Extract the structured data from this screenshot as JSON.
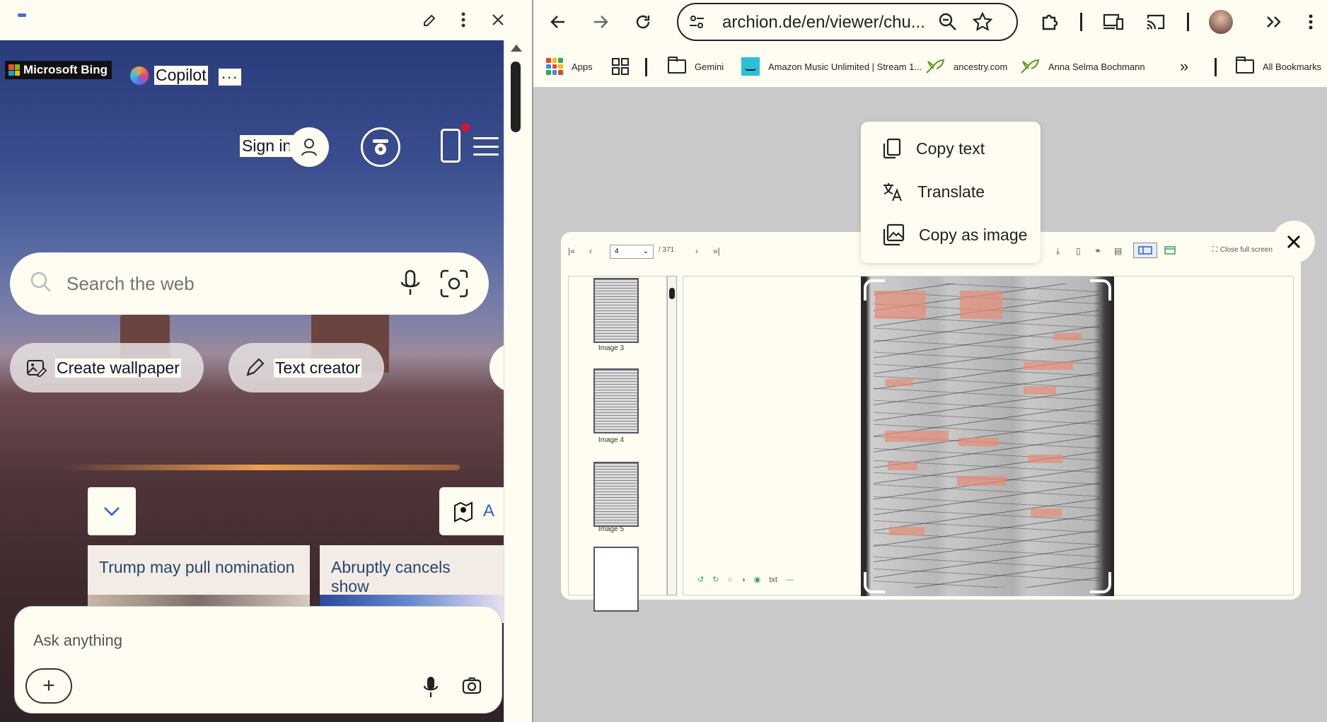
{
  "left_panel": {
    "bing_logo": "Microsoft Bing",
    "copilot_label": "Copilot",
    "more_label": "...",
    "sign_in": "Sign in",
    "search_placeholder": "Search the web",
    "pills": [
      "Create wallpaper",
      "Text creator"
    ],
    "location_partial": "A",
    "news": [
      "Trump may pull nomination",
      "Abruptly cancels show"
    ],
    "ask_placeholder": "Ask anything",
    "plus": "+"
  },
  "browser": {
    "url": "archion.de/en/viewer/chu...",
    "bookmarks": [
      {
        "label": "Apps",
        "icon": "apps-grid-icon"
      },
      {
        "label": "",
        "icon": "tab-groups-icon"
      },
      {
        "label": "Gemini",
        "icon": "folder-icon"
      },
      {
        "label": "Amazon Music Unlimited | Stream 1...",
        "icon": "amazon-icon"
      },
      {
        "label": "ancestry.com",
        "icon": "ancestry-leaf-icon"
      },
      {
        "label": "Anna Selma Bochmann",
        "icon": "ancestry-leaf-icon"
      }
    ],
    "overflow": "»",
    "all_bookmarks": "All Bookmarks"
  },
  "context_menu": {
    "items": [
      "Copy text",
      "Translate",
      "Copy as image"
    ]
  },
  "viewer": {
    "page_value": "4",
    "page_total": "/ 371",
    "close_full_screen": "Close full screen",
    "thumbnails": [
      "Image 3",
      "Image 4",
      "Image 5"
    ],
    "txt_label": "txt"
  },
  "colors": {
    "panel_bg": "#fffdf1",
    "accent_green": "#3a9a6a",
    "highlight": "#e68c78"
  }
}
